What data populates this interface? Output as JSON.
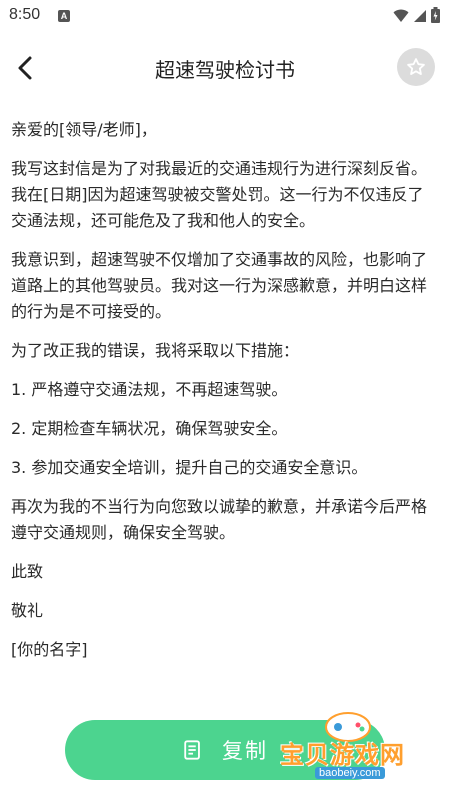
{
  "status_bar": {
    "time": "8:50",
    "notification_icon": "a-icon",
    "wifi_icon": "wifi-icon",
    "signal_icon": "signal-icon",
    "battery_icon": "battery-icon"
  },
  "header": {
    "title": "超速驾驶检讨书",
    "back_icon": "chevron-left-icon",
    "favorite_icon": "star-icon"
  },
  "letter": {
    "paragraphs": [
      "亲爱的[领导/老师]，",
      "我写这封信是为了对我最近的交通违规行为进行深刻反省。我在[日期]因为超速驾驶被交警处罚。这一行为不仅违反了交通法规，还可能危及了我和他人的安全。",
      "我意识到，超速驾驶不仅增加了交通事故的风险，也影响了道路上的其他驾驶员。我对这一行为深感歉意，并明白这样的行为是不可接受的。",
      "为了改正我的错误，我将采取以下措施：",
      "1. 严格遵守交通法规，不再超速驾驶。",
      "2. 定期检查车辆状况，确保驾驶安全。",
      "3. 参加交通安全培训，提升自己的交通安全意识。",
      "再次为我的不当行为向您致以诚挚的歉意，并承诺今后严格遵守交通规则，确保安全驾驶。",
      "此致",
      "敬礼",
      "[你的名字]"
    ]
  },
  "copy_button": {
    "label": "复制",
    "icon": "copy-document-icon",
    "color": "#4cd48f"
  },
  "watermark": {
    "text": "宝贝游戏网",
    "url": "baobeiy.com"
  }
}
